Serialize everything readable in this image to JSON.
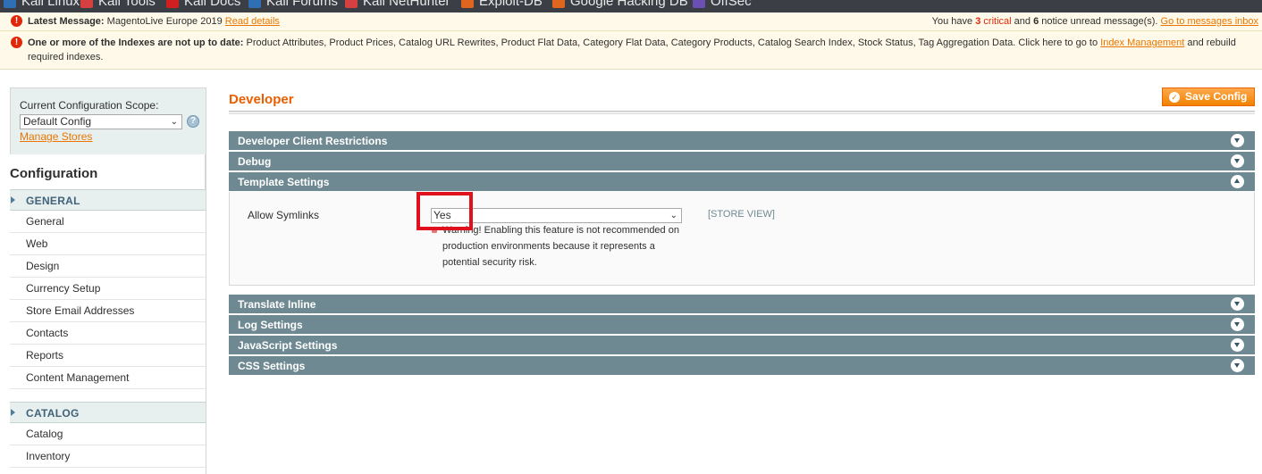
{
  "bookmarks": [
    {
      "label": "Kali Linux",
      "icon": "kali-linux-icon",
      "color": "#2f6fb3"
    },
    {
      "label": "Kali Tools",
      "icon": "kali-tools-icon",
      "color": "#d64040"
    },
    {
      "label": "Kali Docs",
      "icon": "kali-docs-icon",
      "color": "#d01f1f"
    },
    {
      "label": "Kali Forums",
      "icon": "kali-forums-icon",
      "color": "#2f6fb3"
    },
    {
      "label": "Kali NetHunter",
      "icon": "kali-nethunter-icon",
      "color": "#d64040"
    },
    {
      "label": "Exploit-DB",
      "icon": "exploit-db-icon",
      "color": "#e0651f"
    },
    {
      "label": "Google Hacking DB",
      "icon": "ghdb-icon",
      "color": "#e0651f"
    },
    {
      "label": "OffSec",
      "icon": "offsec-icon",
      "color": "#6b4fb3"
    }
  ],
  "latest_message": {
    "prefix": "Latest Message:",
    "text": "MagentoLive Europe 2019",
    "link": "Read details",
    "right_pre": "You have",
    "critical_count": "3",
    "critical_label": "critical",
    "and": "and",
    "notice_count": "6",
    "notice_tail": "notice unread message(s).",
    "inbox_link": "Go to messages inbox"
  },
  "index_notice": {
    "bold": "One or more of the Indexes are not up to date:",
    "text": "Product Attributes, Product Prices, Catalog URL Rewrites, Product Flat Data, Category Flat Data, Category Products, Catalog Search Index, Stock Status, Tag Aggregation Data. Click here to go to",
    "link": "Index Management",
    "tail": "and rebuild required indexes."
  },
  "sidebar": {
    "scope_label": "Current Configuration Scope:",
    "scope_value": "Default Config",
    "manage_stores": "Manage Stores",
    "config_title": "Configuration",
    "general_head": "GENERAL",
    "general_items": [
      "General",
      "Web",
      "Design",
      "Currency Setup",
      "Store Email Addresses",
      "Contacts",
      "Reports",
      "Content Management"
    ],
    "catalog_head": "CATALOG",
    "catalog_items": [
      "Catalog",
      "Inventory"
    ]
  },
  "main": {
    "title": "Developer",
    "save_label": "Save Config",
    "sections_top": [
      "Developer Client Restrictions",
      "Debug",
      "Template Settings"
    ],
    "field": {
      "label": "Allow Symlinks",
      "value": "Yes",
      "scope": "[STORE VIEW]",
      "note": "Warning! Enabling this feature is not recommended on production environments because it represents a potential security risk."
    },
    "sections_bottom": [
      "Translate Inline",
      "Log Settings",
      "JavaScript Settings",
      "CSS Settings"
    ]
  }
}
